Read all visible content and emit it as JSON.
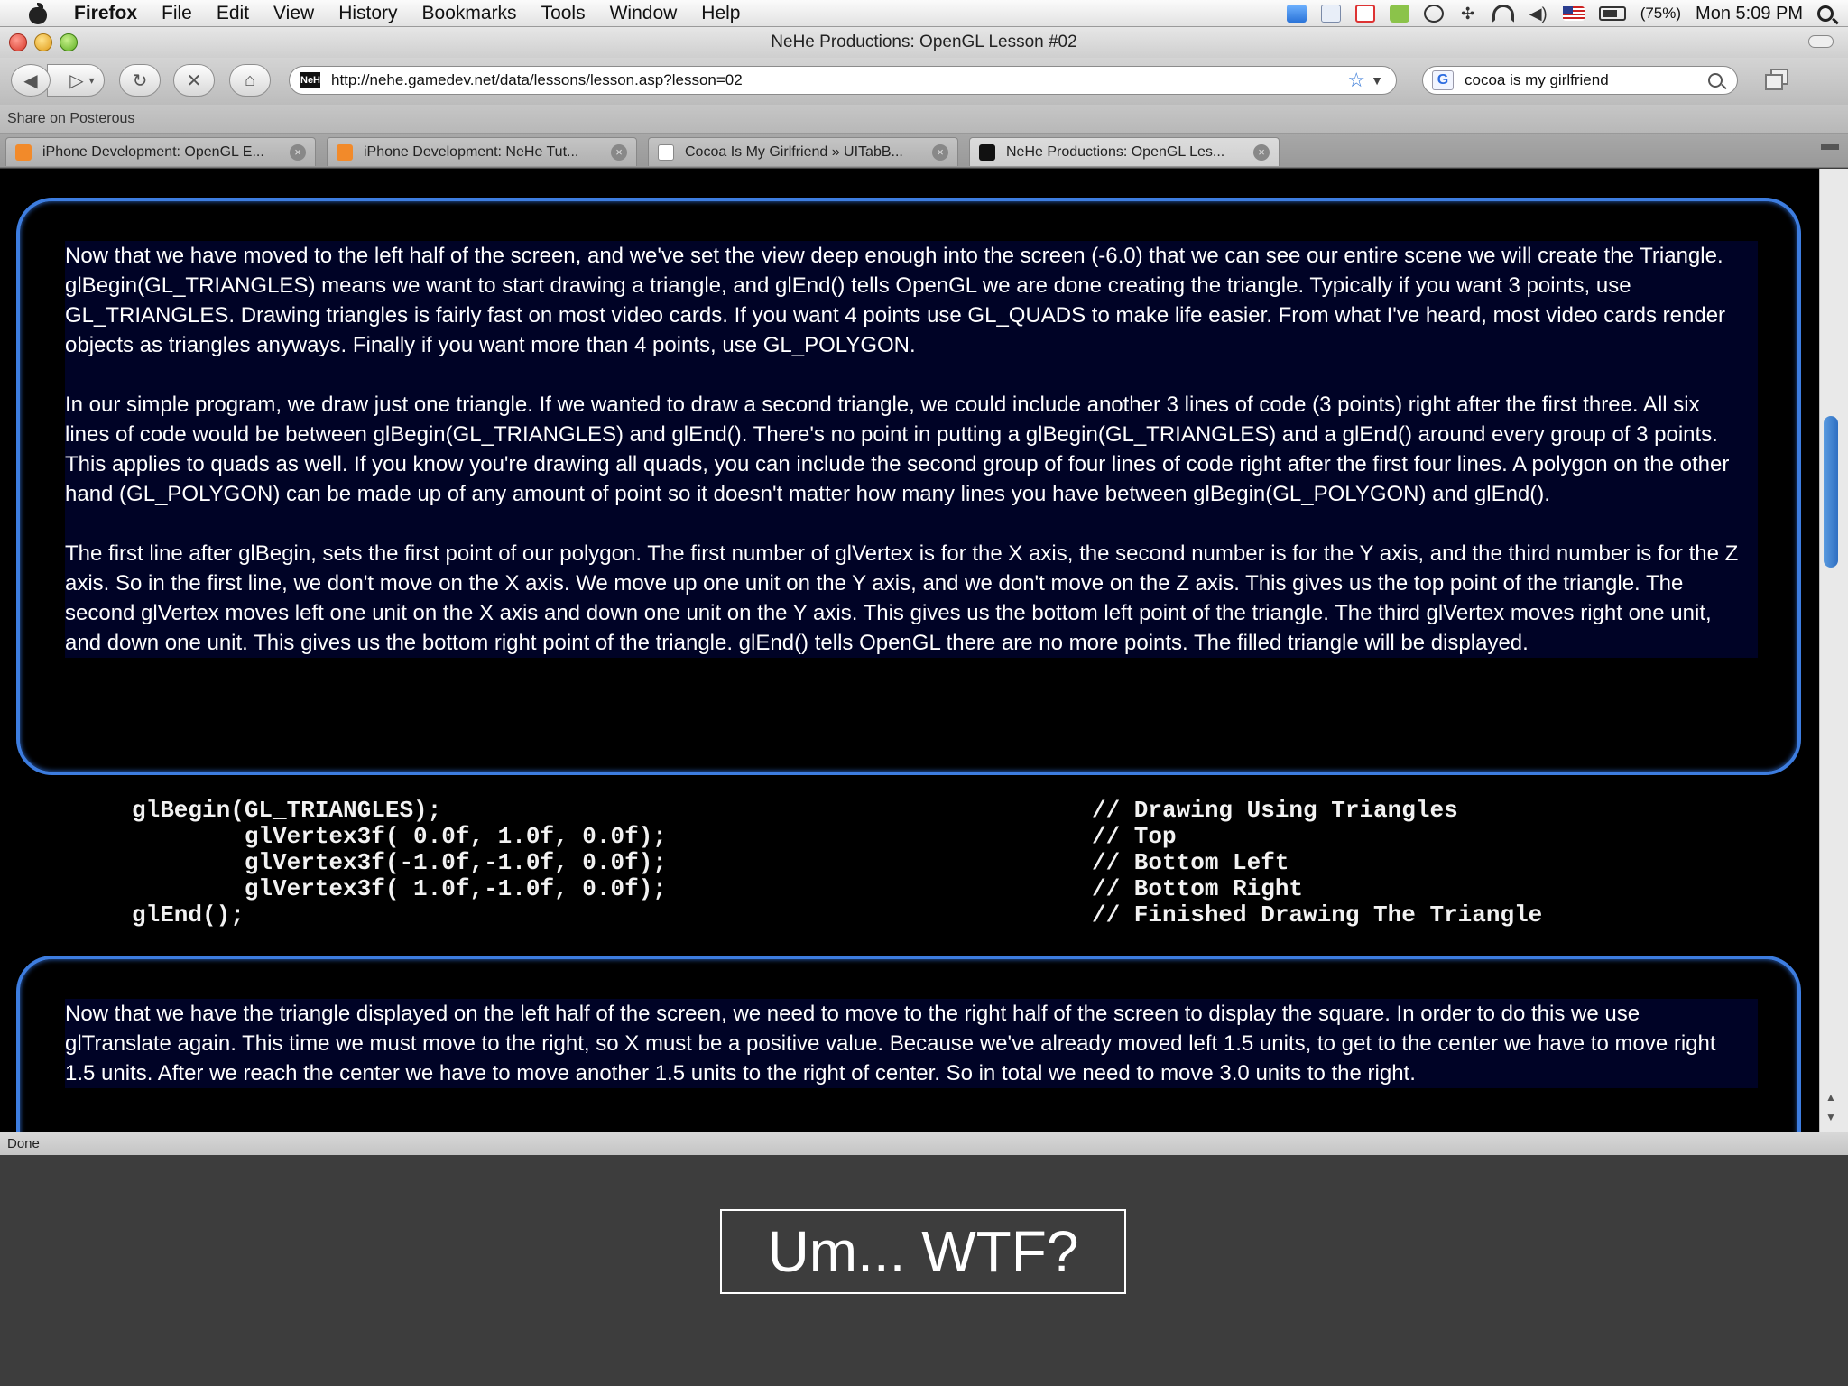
{
  "menubar": {
    "app": "Firefox",
    "items": [
      "File",
      "Edit",
      "View",
      "History",
      "Bookmarks",
      "Tools",
      "Window",
      "Help"
    ],
    "battery": "(75%)",
    "clock": "Mon 5:09 PM"
  },
  "window": {
    "title": "NeHe Productions: OpenGL Lesson #02"
  },
  "toolbar": {
    "site_icon_text": "NeHe",
    "url": "http://nehe.gamedev.net/data/lessons/lesson.asp?lesson=02",
    "search_engine": "G",
    "search_value": "cocoa is my girlfriend"
  },
  "bookmarks": {
    "label": "Share on Posterous"
  },
  "tabs": [
    {
      "label": "iPhone Development: OpenGL E...",
      "icon": "orange-blog-icon"
    },
    {
      "label": "iPhone Development: NeHe Tut...",
      "icon": "orange-blog-icon"
    },
    {
      "label": "Cocoa Is My Girlfriend » UITabB...",
      "icon": "page-icon"
    },
    {
      "label": "NeHe Productions: OpenGL Les...",
      "icon": "nehe-icon",
      "active": true
    }
  ],
  "article": {
    "p1": "Now that we have moved to the left half of the screen, and we've set the view deep enough into the screen (-6.0) that we can see our entire scene we will create the Triangle. glBegin(GL_TRIANGLES) means we want to start drawing a triangle, and glEnd() tells OpenGL we are done creating the triangle. Typically if you want 3 points, use GL_TRIANGLES. Drawing triangles is fairly fast on most video cards. If you want 4 points use GL_QUADS to make life easier. From what I've heard, most video cards render objects as triangles anyways. Finally if you want more than 4 points, use GL_POLYGON.",
    "p2": "In our simple program, we draw just one triangle. If we wanted to draw a second triangle, we could include another 3 lines of code (3 points) right after the first three. All six lines of code would be between glBegin(GL_TRIANGLES) and glEnd(). There's no point in putting a glBegin(GL_TRIANGLES) and a glEnd() around every group of 3 points. This applies to quads as well. If you know you're drawing all quads, you can include the second group of four lines of code right after the first four lines. A polygon on the other hand (GL_POLYGON) can be made up of any amount of point so it doesn't matter how many lines you have between glBegin(GL_POLYGON) and glEnd().",
    "p3": "The first line after glBegin, sets the first point of our polygon. The first number of glVertex is for the X axis, the second number is for the Y axis, and the third number is for the Z axis. So in the first line, we don't move on the X axis. We move up one unit on the Y axis, and we don't move on the Z axis. This gives us the top point of the triangle. The second glVertex moves left one unit on the X axis and down one unit on the Y axis. This gives us the bottom left point of the triangle. The third glVertex moves right one unit, and down one unit. This gives us the bottom right point of the triangle. glEnd() tells OpenGL there are no more points. The filled triangle will be displayed.",
    "code": "glBegin(GL_TRIANGLES);\n        glVertex3f( 0.0f, 1.0f, 0.0f);\n        glVertex3f(-1.0f,-1.0f, 0.0f);\n        glVertex3f( 1.0f,-1.0f, 0.0f);\nglEnd();",
    "comments": "// Drawing Using Triangles\n// Top\n// Bottom Left\n// Bottom Right\n// Finished Drawing The Triangle",
    "p4": "Now that we have the triangle displayed on the left half of the screen, we need to move to the right half of the screen to display the square. In order to do this we use glTranslate again. This time we must move to the right, so X must be a positive value. Because we've already moved left 1.5 units, to get to the center we have to move right 1.5 units. After we reach the center we have to move another 1.5 units to the right of center. So in total we need to move 3.0 units to the right."
  },
  "status": {
    "text": "Done"
  },
  "slide": {
    "caption": "Um... WTF?"
  }
}
